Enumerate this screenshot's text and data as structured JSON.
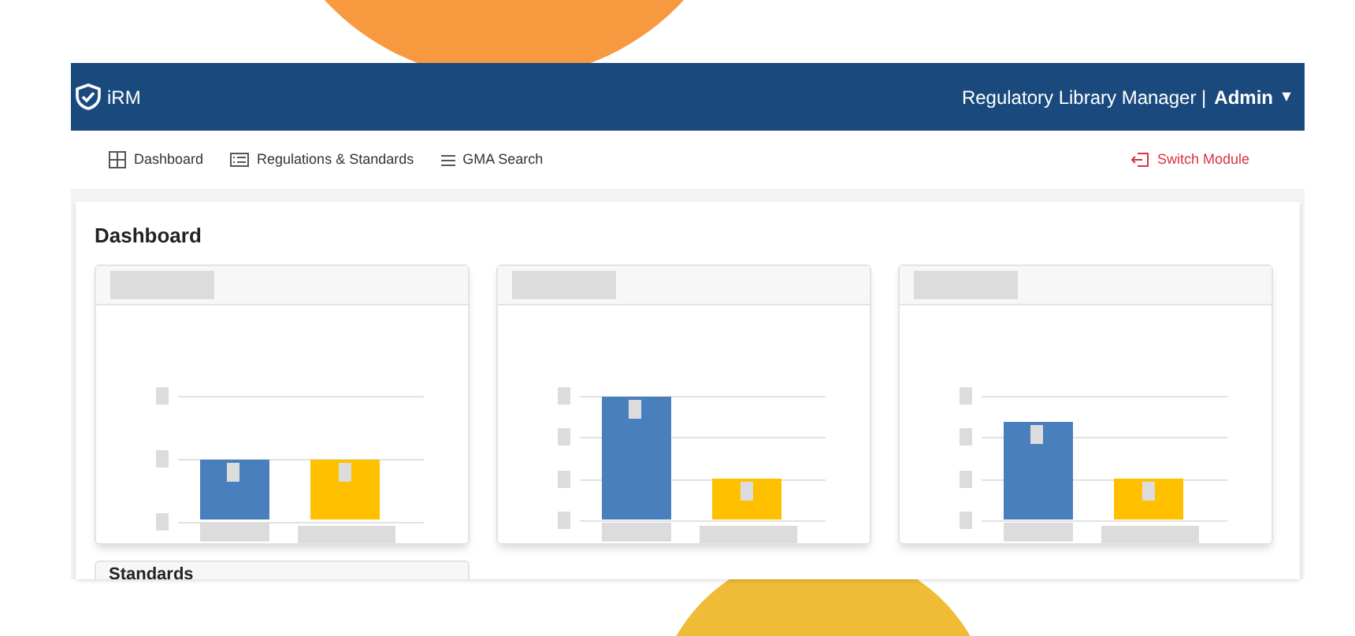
{
  "header": {
    "logo": "iRM",
    "app_name": "Regulatory Library Manager |",
    "user": "Admin",
    "caret": "▾"
  },
  "nav": {
    "items": [
      {
        "kind": "grid",
        "label": "Dashboard"
      },
      {
        "kind": "list",
        "label": "Regulations & Standards"
      },
      {
        "kind": "lines",
        "label": "GMA Search"
      }
    ],
    "switch_module": "Switch Module"
  },
  "page_title": "Dashboard",
  "next_section": "Standards"
}
